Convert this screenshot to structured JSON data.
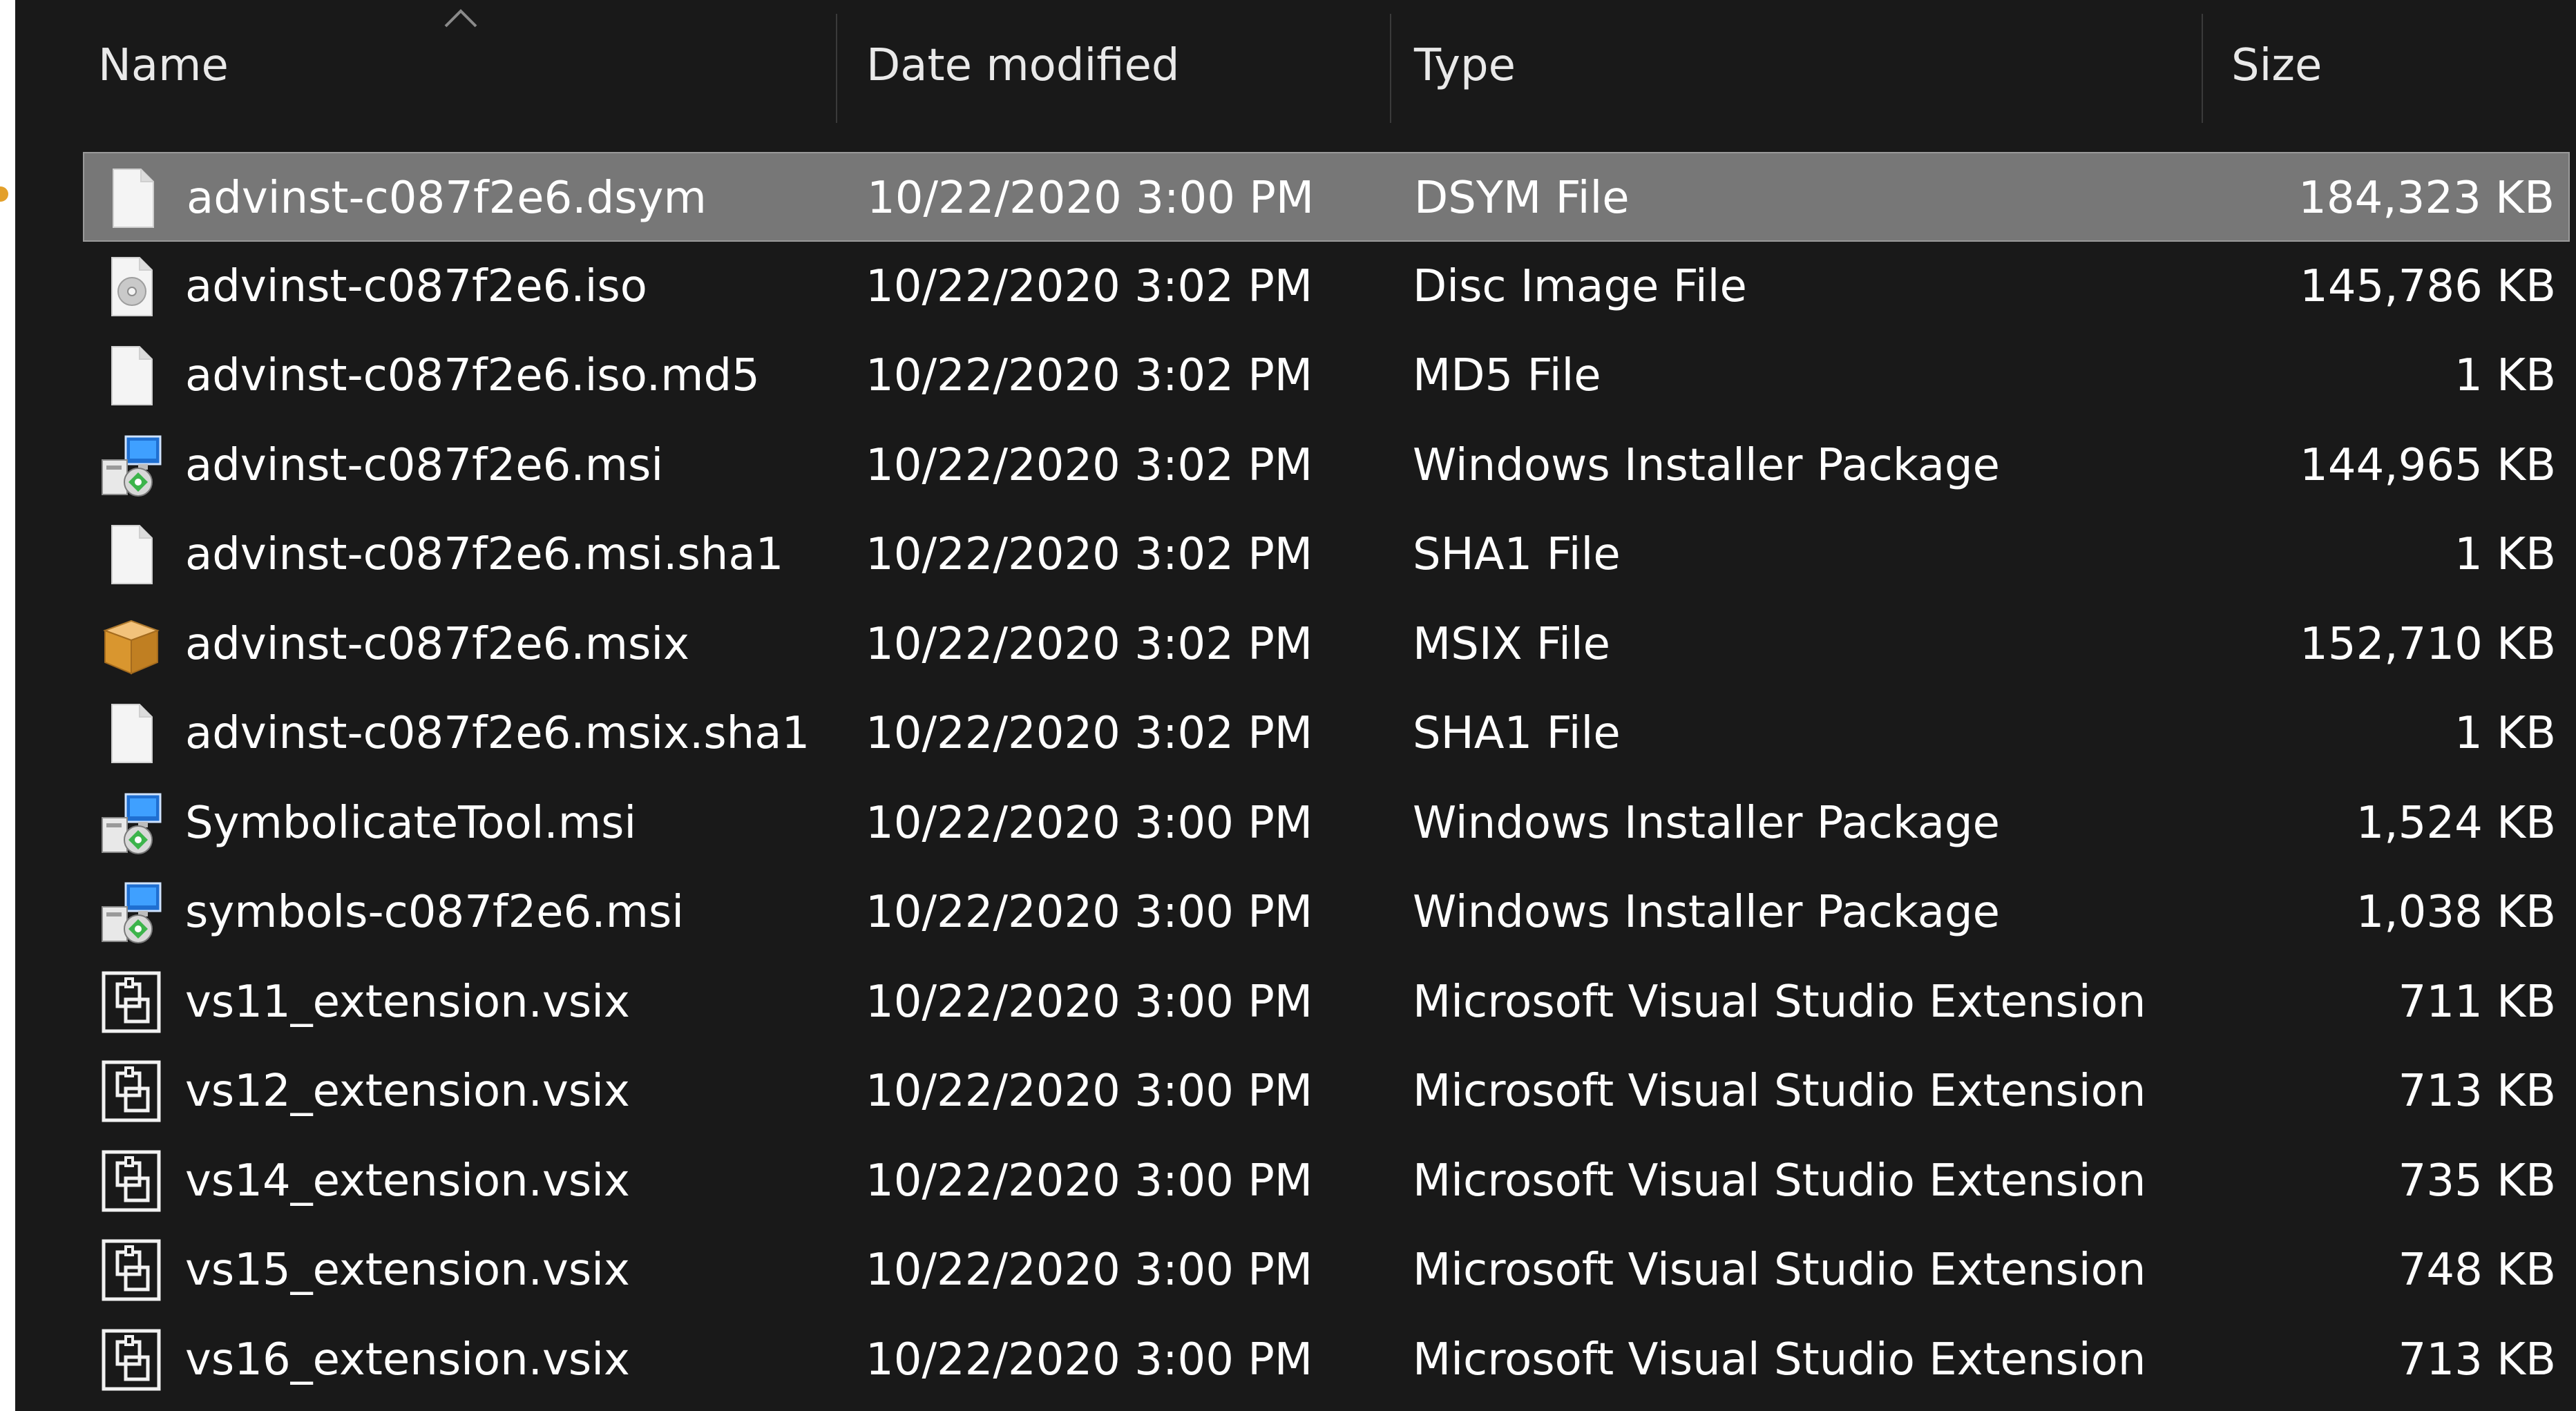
{
  "columns": {
    "name": "Name",
    "date": "Date modified",
    "type": "Type",
    "size": "Size"
  },
  "files": [
    {
      "name": "advinst-c087f2e6.dsym",
      "date": "10/22/2020 3:00 PM",
      "type": "DSYM File",
      "size": "184,323 KB",
      "icon": "blank-file-icon",
      "selected": true
    },
    {
      "name": "advinst-c087f2e6.iso",
      "date": "10/22/2020 3:02 PM",
      "type": "Disc Image File",
      "size": "145,786 KB",
      "icon": "disc-image-icon"
    },
    {
      "name": "advinst-c087f2e6.iso.md5",
      "date": "10/22/2020 3:02 PM",
      "type": "MD5 File",
      "size": "1 KB",
      "icon": "blank-file-icon"
    },
    {
      "name": "advinst-c087f2e6.msi",
      "date": "10/22/2020 3:02 PM",
      "type": "Windows Installer Package",
      "size": "144,965 KB",
      "icon": "installer-package-icon"
    },
    {
      "name": "advinst-c087f2e6.msi.sha1",
      "date": "10/22/2020 3:02 PM",
      "type": "SHA1 File",
      "size": "1 KB",
      "icon": "blank-file-icon"
    },
    {
      "name": "advinst-c087f2e6.msix",
      "date": "10/22/2020 3:02 PM",
      "type": "MSIX File",
      "size": "152,710 KB",
      "icon": "package-box-icon"
    },
    {
      "name": "advinst-c087f2e6.msix.sha1",
      "date": "10/22/2020 3:02 PM",
      "type": "SHA1 File",
      "size": "1 KB",
      "icon": "blank-file-icon"
    },
    {
      "name": "SymbolicateTool.msi",
      "date": "10/22/2020 3:00 PM",
      "type": "Windows Installer Package",
      "size": "1,524 KB",
      "icon": "installer-package-icon"
    },
    {
      "name": "symbols-c087f2e6.msi",
      "date": "10/22/2020 3:00 PM",
      "type": "Windows Installer Package",
      "size": "1,038 KB",
      "icon": "installer-package-icon"
    },
    {
      "name": "vs11_extension.vsix",
      "date": "10/22/2020 3:00 PM",
      "type": "Microsoft Visual Studio Extension",
      "size": "711 KB",
      "icon": "vsix-extension-icon"
    },
    {
      "name": "vs12_extension.vsix",
      "date": "10/22/2020 3:00 PM",
      "type": "Microsoft Visual Studio Extension",
      "size": "713 KB",
      "icon": "vsix-extension-icon"
    },
    {
      "name": "vs14_extension.vsix",
      "date": "10/22/2020 3:00 PM",
      "type": "Microsoft Visual Studio Extension",
      "size": "735 KB",
      "icon": "vsix-extension-icon"
    },
    {
      "name": "vs15_extension.vsix",
      "date": "10/22/2020 3:00 PM",
      "type": "Microsoft Visual Studio Extension",
      "size": "748 KB",
      "icon": "vsix-extension-icon"
    },
    {
      "name": "vs16_extension.vsix",
      "date": "10/22/2020 3:00 PM",
      "type": "Microsoft Visual Studio Extension",
      "size": "713 KB",
      "icon": "vsix-extension-icon"
    }
  ],
  "colors": {
    "background": "#191919",
    "selected_row": "#777777",
    "text": "#ffffff",
    "focus_accent": "#e3a02b"
  }
}
